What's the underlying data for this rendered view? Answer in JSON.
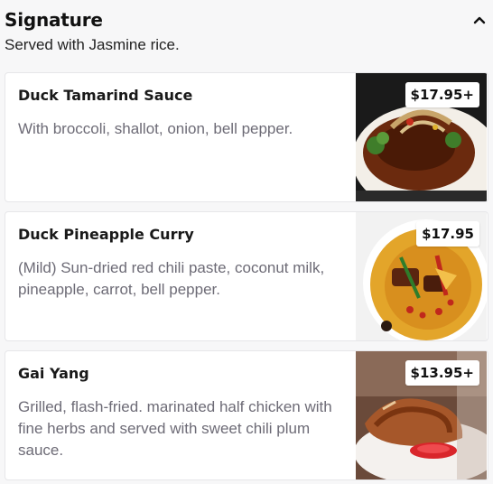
{
  "section": {
    "title": "Signature",
    "subtitle": "Served with Jasmine rice.",
    "collapse_icon": "chevron-up-icon"
  },
  "items": [
    {
      "name": "Duck Tamarind Sauce",
      "description": "With broccoli, shallot, onion, bell pepper.",
      "price": "$17.95+"
    },
    {
      "name": "Duck Pineapple Curry",
      "description": "(Mild) Sun-dried red chili paste, coconut milk, pineapple, carrot, bell pepper.",
      "price": "$17.95"
    },
    {
      "name": "Gai Yang",
      "description": "Grilled, flash-fried. marinated half chicken with fine herbs and served with sweet chili plum sauce.",
      "price": "$13.95+"
    }
  ]
}
